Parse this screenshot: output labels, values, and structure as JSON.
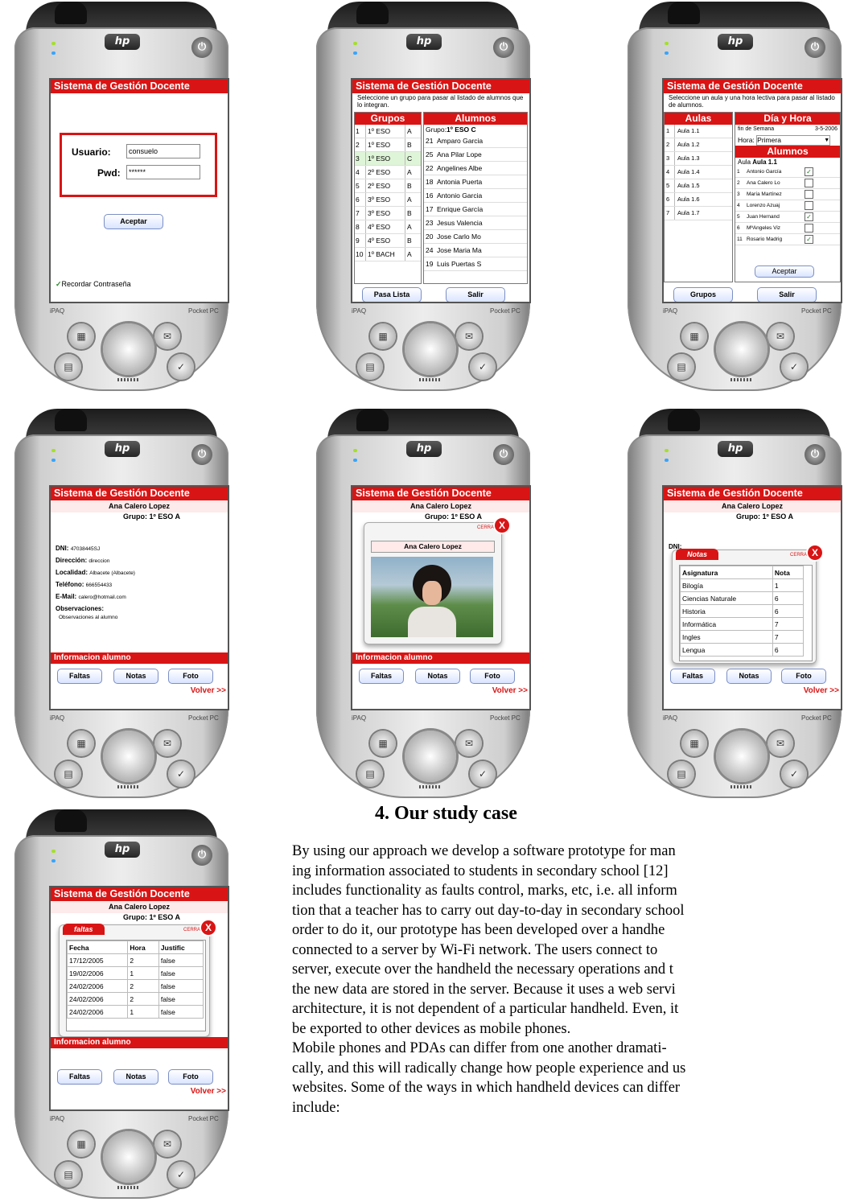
{
  "common": {
    "header": "Sistema de Gestión Docente",
    "brand_left": "iPAQ",
    "brand_right": "Pocket PC",
    "logo": "hp",
    "power": "⏻",
    "accent": "#d91414"
  },
  "login": {
    "usuario_label": "Usuario:",
    "usuario_value": "consuelo",
    "pwd_label": "Pwd:",
    "pwd_value": "******",
    "accept": "Aceptar",
    "remember": "Recordar Contraseña"
  },
  "groups": {
    "instruction": "Seleccione un grupo para pasar al listado de alumnos que lo integran.",
    "grupos_head": "Grupos",
    "alumnos_head": "Alumnos",
    "grupo_label": "Grupo:",
    "grupo_value": "1º ESO C",
    "grupos": [
      {
        "n": "1",
        "curso": "1º ESO",
        "letra": "A"
      },
      {
        "n": "2",
        "curso": "1º ESO",
        "letra": "B"
      },
      {
        "n": "3",
        "curso": "1º ESO",
        "letra": "C"
      },
      {
        "n": "4",
        "curso": "2º ESO",
        "letra": "A"
      },
      {
        "n": "5",
        "curso": "2º ESO",
        "letra": "B"
      },
      {
        "n": "6",
        "curso": "3º ESO",
        "letra": "A"
      },
      {
        "n": "7",
        "curso": "3º ESO",
        "letra": "B"
      },
      {
        "n": "8",
        "curso": "4º ESO",
        "letra": "A"
      },
      {
        "n": "9",
        "curso": "4º ESO",
        "letra": "B"
      },
      {
        "n": "10",
        "curso": "1º BACH",
        "letra": "A"
      }
    ],
    "alumnos": [
      {
        "n": "21",
        "name": "Amparo Garcia"
      },
      {
        "n": "25",
        "name": "Ana Pilar Lope"
      },
      {
        "n": "22",
        "name": "Angelines Albe"
      },
      {
        "n": "18",
        "name": "Antonia Puerta"
      },
      {
        "n": "16",
        "name": "Antonio Garcia"
      },
      {
        "n": "17",
        "name": "Enrique García"
      },
      {
        "n": "23",
        "name": "Jesus Valencia"
      },
      {
        "n": "20",
        "name": "Jose Carlo Mo"
      },
      {
        "n": "24",
        "name": "Jose Maria Ma"
      },
      {
        "n": "19",
        "name": "Luis Puertas S"
      }
    ],
    "btn_left": "Pasa Lista",
    "btn_right": "Salir"
  },
  "aulas": {
    "instruction": "Seleccione un aula y una hora lectiva para pasar al listado de alumnos.",
    "aulas_head": "Aulas",
    "dia_head": "Día y Hora",
    "fin_label": "fin de Semana",
    "date": "3-5-2006",
    "hora_label": "Hora:",
    "hora_value": "Primera",
    "alumnos_head": "Alumnos",
    "aula_label": "Aula",
    "aula_value": "Aula 1.1",
    "aulas": [
      "Aula 1.1",
      "Aula 1.2",
      "Aula 1.3",
      "Aula 1.4",
      "Aula 1.5",
      "Aula 1.6",
      "Aula 1.7"
    ],
    "students": [
      {
        "n": "1",
        "name": "Antonio García",
        "checked": true
      },
      {
        "n": "2",
        "name": "Ana Calero Lo",
        "checked": false
      },
      {
        "n": "3",
        "name": "María Martínez",
        "checked": false
      },
      {
        "n": "4",
        "name": "Lorenzo Azuaj",
        "checked": false
      },
      {
        "n": "5",
        "name": "Juan Hernand",
        "checked": true
      },
      {
        "n": "6",
        "name": "MªAngeles Viz",
        "checked": false
      },
      {
        "n": "11",
        "name": "Rosario Madrig",
        "checked": true
      }
    ],
    "accept": "Aceptar",
    "btn_left": "Grupos",
    "btn_right": "Salir"
  },
  "student": {
    "name": "Ana Calero Lopez",
    "grupo": "Grupo: 1º ESO A",
    "dni_label": "DNI:",
    "dni": "47038445SJ",
    "dir_label": "Dirección:",
    "dir": "direccion",
    "loc_label": "Localidad:",
    "loc": "Albacete (Albacete)",
    "tel_label": "Teléfono:",
    "tel": "666554433",
    "mail_label": "E-Mail:",
    "mail": "calero@hotmail.com",
    "obs_label": "Observaciones:",
    "obs": "Observaciones al alumno",
    "info_bar": "Informacion alumno",
    "faltas": "Faltas",
    "notas": "Notas",
    "foto": "Foto",
    "volver": "Volver >>"
  },
  "popups": {
    "cerrar": "CERRAR",
    "x": "X",
    "notas_title": "Notas",
    "notas_headers": [
      "Asignatura",
      "Nota"
    ],
    "notas": [
      [
        "Bilogía",
        "1"
      ],
      [
        "Ciencias Naturale",
        "6"
      ],
      [
        "Historia",
        "6"
      ],
      [
        "Informática",
        "7"
      ],
      [
        "Ingles",
        "7"
      ],
      [
        "Lengua",
        "6"
      ]
    ],
    "faltas_title": "faltas",
    "faltas_headers": [
      "Fecha",
      "Hora",
      "Justific"
    ],
    "faltas": [
      [
        "17/12/2005",
        "2",
        "false"
      ],
      [
        "19/02/2006",
        "1",
        "false"
      ],
      [
        "24/02/2006",
        "2",
        "false"
      ],
      [
        "24/02/2006",
        "2",
        "false"
      ],
      [
        "24/02/2006",
        "1",
        "false"
      ]
    ]
  },
  "doc": {
    "title": "4. Our study case",
    "lines": [
      "By using our approach we develop a software prototype for man",
      "ing information associated to students in secondary school [12]",
      "includes functionality as faults control, marks, etc, i.e. all inform",
      "tion that a teacher has to carry out day-to-day in secondary school",
      "order to do it, our prototype has been developed over a handhe",
      "connected to a server by Wi-Fi network. The users connect to",
      "server, execute over the handheld the necessary operations and t",
      "the new data are stored in the server. Because it uses a web servi",
      "architecture, it is not dependent of a particular handheld. Even, it",
      "be exported to other devices as mobile phones.",
      "   Mobile phones and PDAs can differ from one another dramati-",
      "cally, and this will radically change how people experience and us",
      "websites. Some of the ways in which handheld devices can differ",
      "include:"
    ]
  }
}
